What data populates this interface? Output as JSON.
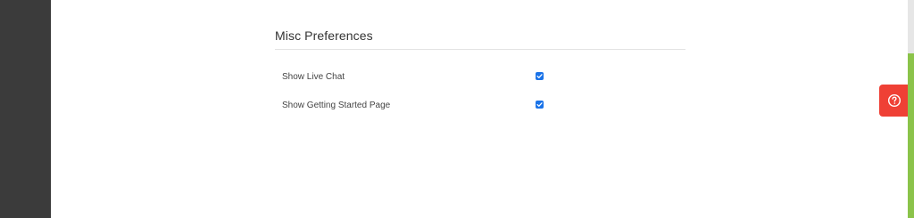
{
  "section": {
    "title": "Misc Preferences"
  },
  "preferences": [
    {
      "label": "Show Live Chat",
      "checked": true
    },
    {
      "label": "Show Getting Started Page",
      "checked": true
    }
  ],
  "help_button": {
    "icon": "question-circle-icon",
    "color": "#ef4035"
  },
  "colors": {
    "sidebar": "#3b3b3b",
    "checkbox": "#1a73e8",
    "scrollbar_accent": "#8bc34a"
  }
}
